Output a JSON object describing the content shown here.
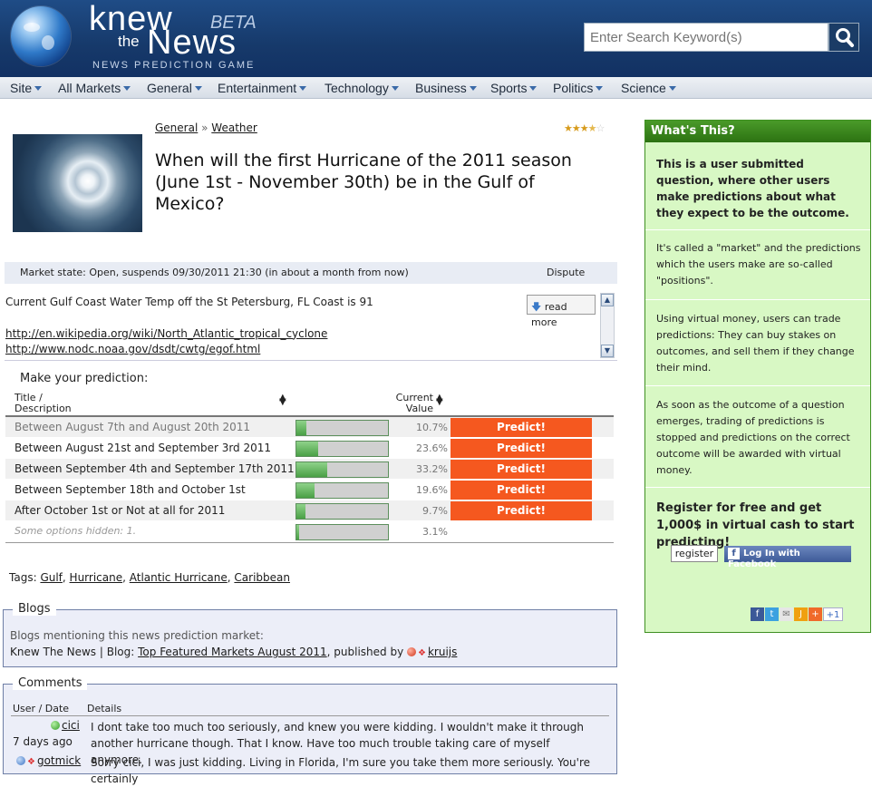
{
  "header": {
    "logo_knew": "knew",
    "logo_the": "the",
    "logo_news": "News",
    "logo_beta": "BETA",
    "logo_sub": "NEWS PREDICTION GAME",
    "search_placeholder": "Enter Search Keyword(s)"
  },
  "nav": {
    "items": [
      {
        "label": "Site"
      },
      {
        "label": "All Markets"
      },
      {
        "label": "General"
      },
      {
        "label": "Entertainment"
      },
      {
        "label": "Technology"
      },
      {
        "label": "Business"
      },
      {
        "label": "Sports"
      },
      {
        "label": "Politics"
      },
      {
        "label": "Science"
      }
    ]
  },
  "question": {
    "breadcrumb": [
      "General",
      "Weather"
    ],
    "breadcrumb_sep": "»",
    "rating": 3.5,
    "rating_max": 5,
    "title": "When will the first Hurricane of the 2011 season (June 1st - November 30th) be in the Gulf of Mexico?",
    "market_state": "Market state: Open, suspends 09/30/2011 21:30 (in about a month from now)",
    "dispute": "Dispute",
    "description": "Current Gulf Coast Water Temp off the St Petersburg, FL Coast is 91",
    "links": [
      "http://en.wikipedia.org/wiki/North_Atlantic_tropical_cyclone",
      "http://www.nodc.noaa.gov/dsdt/cwtg/egof.html"
    ],
    "read_more": "read more"
  },
  "prediction": {
    "heading": "Make your prediction:",
    "col_title_line1": "Title /",
    "col_title_line2": "Description",
    "col_value_line1": "Current",
    "col_value_line2": "Value",
    "predict_label": "Predict!",
    "options": [
      {
        "label": "Between August 7th and August 20th 2011",
        "value": "10.7%",
        "fraction": 0.107
      },
      {
        "label": "Between August 21st and September 3rd 2011",
        "value": "23.6%",
        "fraction": 0.236
      },
      {
        "label": "Between September 4th and September 17th 2011",
        "value": "33.2%",
        "fraction": 0.332
      },
      {
        "label": "Between September 18th and October 1st",
        "value": "19.6%",
        "fraction": 0.196
      },
      {
        "label": "After October 1st or Not at all for 2011",
        "value": "9.7%",
        "fraction": 0.097
      }
    ],
    "hidden": {
      "label": "Some options hidden: 1.",
      "value": "3.1%",
      "fraction": 0.031
    }
  },
  "tags": {
    "prefix": "Tags:",
    "items": [
      "Gulf",
      "Hurricane",
      "Atlantic Hurricane",
      "Caribbean"
    ]
  },
  "blogs": {
    "legend": "Blogs",
    "intro": "Blogs mentioning this news prediction market:",
    "source": "Knew The News | Blog:",
    "post": "Top Featured Markets August 2011",
    "published_by": ", published by",
    "author": "kruijs"
  },
  "comments": {
    "legend": "Comments",
    "col_user": "User / Date",
    "col_details": "Details",
    "items": [
      {
        "user": "cici",
        "date": "7 days ago",
        "text": "I dont take too much too seriously, and knew you were kidding. I wouldn't make it through another hurricane though. That I know. Have too much trouble taking care of myself anymore."
      },
      {
        "user": "gotmick",
        "date": "",
        "text": "Sorry cici, I was just kidding. Living in Florida, I'm sure you take them more seriously. You're certainly"
      }
    ]
  },
  "sidebar": {
    "title": "What's This?",
    "intro": "This is a user submitted question, where other users make predictions about what they expect to be the outcome.",
    "p1": "It's called a \"market\" and the predictions which the users make are so-called \"positions\".",
    "p2": "Using virtual money, users can trade predictions: They can buy stakes on outcomes, and sell them if they change their mind.",
    "p3": "As soon as the outcome of a question emerges, trading of predictions is stopped and predictions on the correct outcome will be awarded with virtual money.",
    "register_text": "Register for free and get 1,000$ in virtual cash to start predicting!",
    "register_button": "register",
    "facebook_button": "Log In with Facebook",
    "plus_one": "+1"
  },
  "colors": {
    "header_bg": "#16396a",
    "predict_button": "#f5581f",
    "sidebar_bg": "#d8f8c4",
    "sidebar_head": "#2c7212",
    "bar_fill": "#4aa046"
  }
}
